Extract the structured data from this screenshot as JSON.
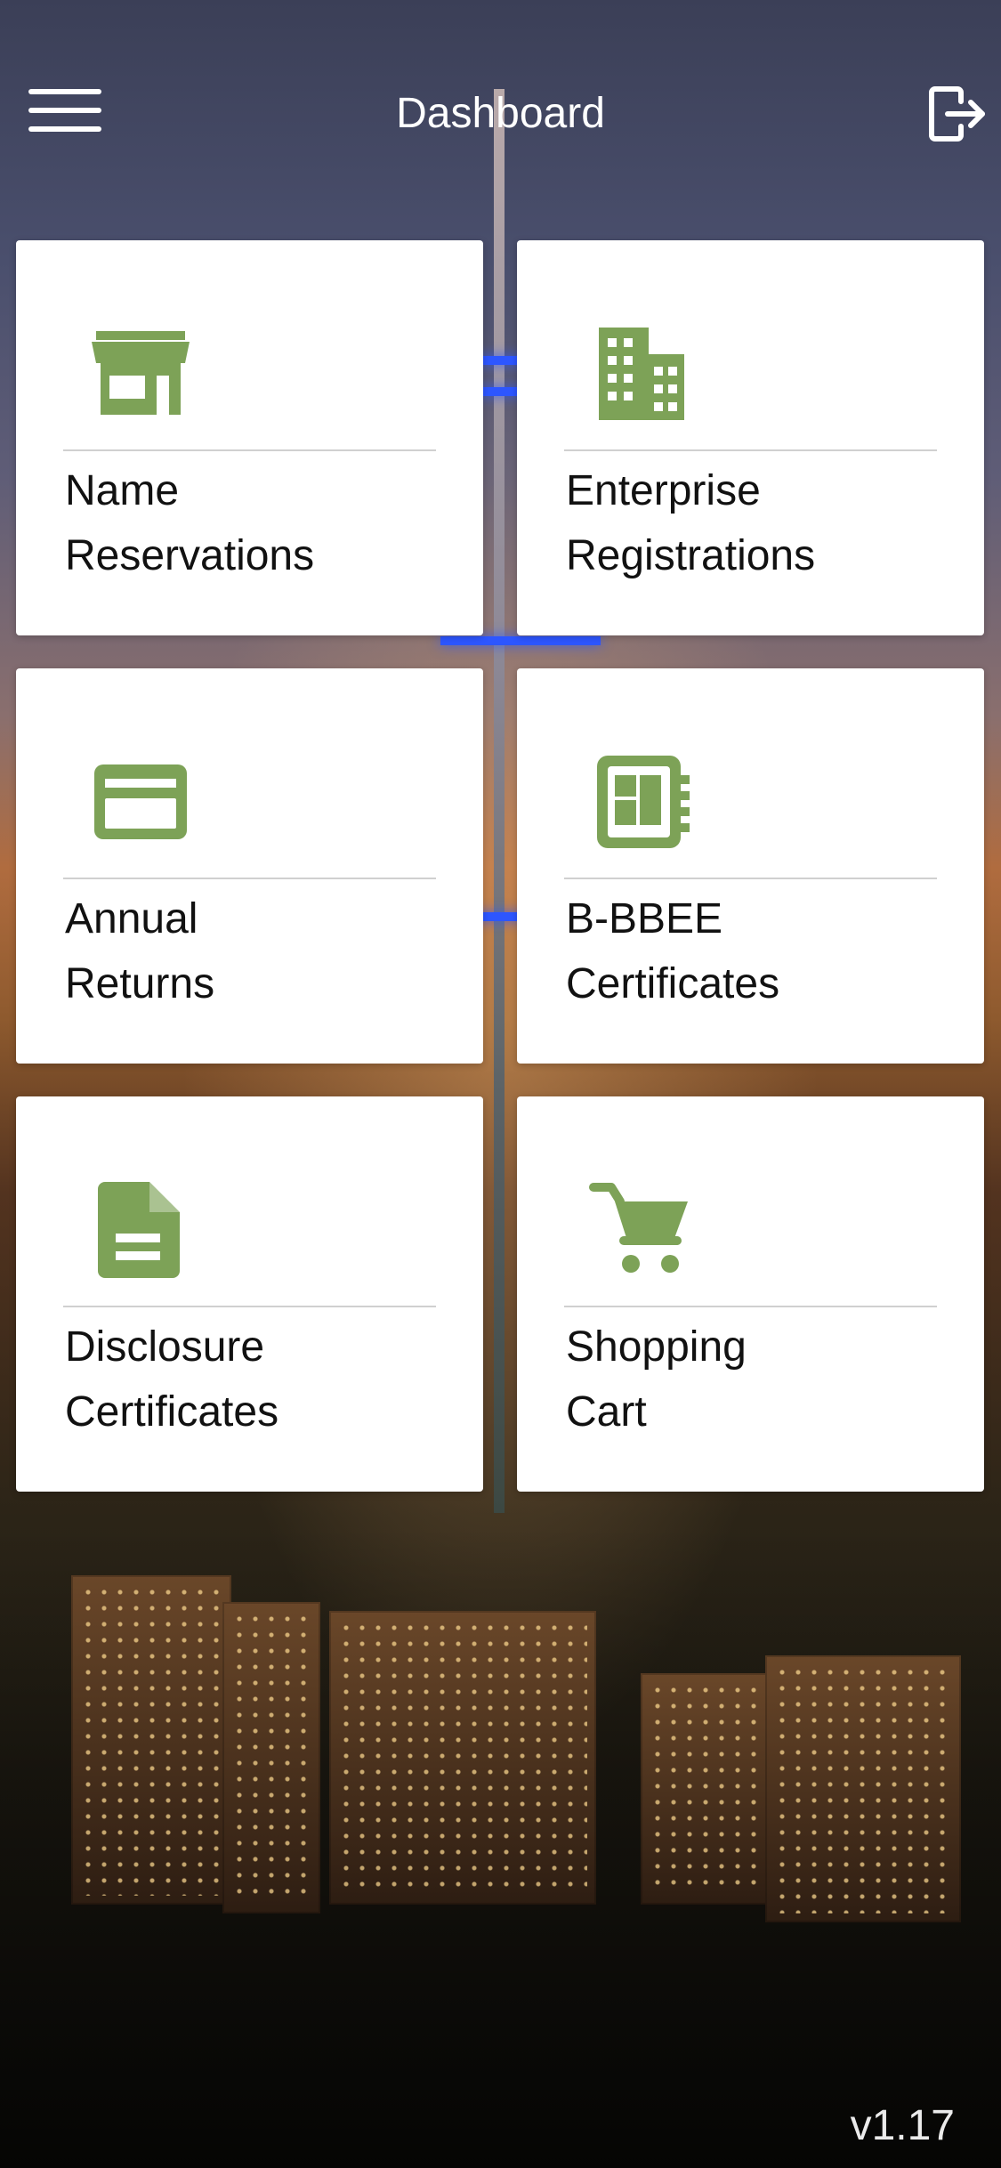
{
  "header": {
    "title": "Dashboard"
  },
  "cards": [
    {
      "label_line1": "Name",
      "label_line2": "Reservations",
      "icon": "storefront-icon"
    },
    {
      "label_line1": "Enterprise",
      "label_line2": "Registrations",
      "icon": "building-icon"
    },
    {
      "label_line1": "Annual",
      "label_line2": "Returns",
      "icon": "credit-card-icon"
    },
    {
      "label_line1": "B-BBEE",
      "label_line2": "Certificates",
      "icon": "certificate-icon"
    },
    {
      "label_line1": "Disclosure",
      "label_line2": "Certificates",
      "icon": "document-icon"
    },
    {
      "label_line1": "Shopping",
      "label_line2": "Cart",
      "icon": "shopping-cart-icon"
    }
  ],
  "footer": {
    "version": "v1.17"
  },
  "colors": {
    "accent": "#7da257",
    "card_bg": "#ffffff",
    "text": "#111111",
    "header_text": "#ffffff"
  }
}
